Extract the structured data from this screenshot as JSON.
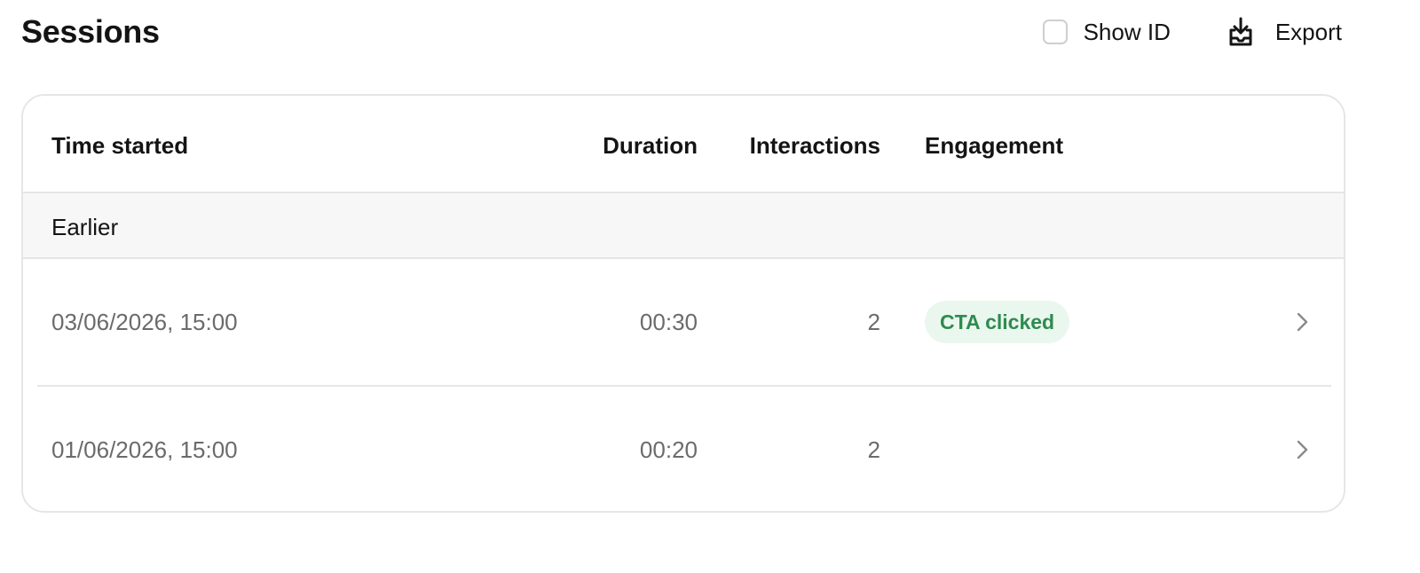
{
  "header": {
    "title": "Sessions",
    "show_id_label": "Show ID",
    "show_id_checked": false,
    "export_label": "Export"
  },
  "table": {
    "columns": {
      "time_started": "Time started",
      "duration": "Duration",
      "interactions": "Interactions",
      "engagement": "Engagement"
    },
    "group_label": "Earlier",
    "rows": [
      {
        "time_started": "03/06/2026, 15:00",
        "duration": "00:30",
        "interactions": "2",
        "engagement": "CTA clicked"
      },
      {
        "time_started": "01/06/2026, 15:00",
        "duration": "00:20",
        "interactions": "2",
        "engagement": ""
      }
    ]
  },
  "icons": {
    "export": "download-tray-icon",
    "row_open": "chevron-right-icon"
  },
  "colors": {
    "badge_background": "#eaf7ee",
    "badge_text": "#2e8b4f",
    "border": "#e6e6e6",
    "muted_text": "#6b6b6b"
  }
}
